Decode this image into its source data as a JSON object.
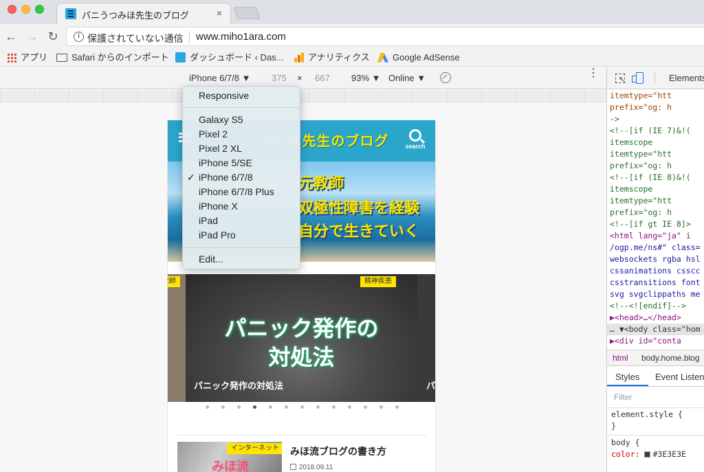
{
  "browser": {
    "tab_title": "パニうつみほ先生のブログ",
    "tab_close": "×",
    "security_text": "保護されていない通信",
    "url": "www.miho1ara.com",
    "info_glyph": "i"
  },
  "bookmarks": [
    {
      "label": "アプリ",
      "icon": "apps-grid-icon"
    },
    {
      "label": "Safari からのインポート",
      "icon": "folder-icon"
    },
    {
      "label": "ダッシュボード ‹ Das...",
      "icon": "dashboard-favicon"
    },
    {
      "label": "アナリティクス",
      "icon": "analytics-icon"
    },
    {
      "label": "Google AdSense",
      "icon": "adsense-icon"
    }
  ],
  "device_toolbar": {
    "device": "iPhone 6/7/8 ▼",
    "width": "375",
    "times": "×",
    "height": "667",
    "zoom": "93% ▼",
    "network": "Online ▼",
    "menu": "⋮"
  },
  "device_menu": {
    "items": [
      "Responsive",
      "Galaxy S5",
      "Pixel 2",
      "Pixel 2 XL",
      "iPhone 5/SE",
      "iPhone 6/7/8",
      "iPhone 6/7/8 Plus",
      "iPhone X",
      "iPad",
      "iPad Pro",
      "Edit..."
    ],
    "checkmark": "✓",
    "selected": "iPhone 6/7/8"
  },
  "site": {
    "title": "パニうつみほ先生のブログ",
    "search_label": "search",
    "hero_lines": [
      "元教師",
      "双極性障害を経験",
      "自分で生きていく"
    ],
    "slide_category": "精神疾患",
    "slide_left_category": "教師",
    "slide_headline_1": "パニック発作の",
    "slide_headline_2": "対処法",
    "slide_caption": "パニック発作の対処法",
    "slide_caption_right": "パ",
    "dots": 13,
    "active_dot": 3,
    "article": {
      "category": "インターネット",
      "thumb_text": "みほ流",
      "title": "みほ流ブログの書き方",
      "date": "2018.09.11"
    }
  },
  "devtools": {
    "tab": "Elements",
    "dom_lines": [
      {
        "text": "      itemtype=\"htt",
        "cls": "attr"
      },
      {
        "text": "      prefix=\"og: h",
        "cls": "attr"
      },
      {
        "text": " ->",
        "cls": "comment"
      },
      {
        "text": " <!--[if (IE 7)&!(",
        "cls": "comment"
      },
      {
        "text": "      itemscope",
        "cls": "comment"
      },
      {
        "text": "      itemtype=\"htt",
        "cls": "comment"
      },
      {
        "text": "      prefix=\"og: h",
        "cls": "comment"
      },
      {
        "text": " <!--[if (IE 8)&!(",
        "cls": "comment"
      },
      {
        "text": "      itemscope",
        "cls": "comment"
      },
      {
        "text": "      itemtype=\"htt",
        "cls": "comment"
      },
      {
        "text": "      prefix=\"og: h",
        "cls": "comment"
      },
      {
        "text": " <!--[if gt IE 8]>",
        "cls": "comment"
      },
      {
        "text": "  <html lang=\"ja\" i",
        "cls": ""
      },
      {
        "text": "/ogp.me/ns#\" class=",
        "cls": "blue"
      },
      {
        "text": "websockets rgba hsl",
        "cls": "blue"
      },
      {
        "text": "cssanimations csscc",
        "cls": "blue"
      },
      {
        "text": "csstransitions font",
        "cls": "blue"
      },
      {
        "text": "svg svgclippaths me",
        "cls": "blue"
      },
      {
        "text": "    <!--<![endif]-->",
        "cls": "comment"
      },
      {
        "text": "   ▶<head>…</head>",
        "cls": ""
      },
      {
        "text": "… ▼<body class=\"hom",
        "cls": "sel"
      },
      {
        "text": "     ▶<div id=\"conta",
        "cls": ""
      }
    ],
    "breadcrumb_html": "html",
    "breadcrumb_body": "body.home.blog",
    "styles_tab": "Styles",
    "events_tab": "Event Listeners",
    "filter_placeholder": "Filter",
    "css_rules": [
      {
        "text": "element.style {",
        "cls": ""
      },
      {
        "text": "}",
        "cls": ""
      },
      {
        "text": "body {",
        "cls": ""
      },
      {
        "text": "  color: ",
        "cls": "prop",
        "value": "#3E3E3E"
      }
    ]
  }
}
